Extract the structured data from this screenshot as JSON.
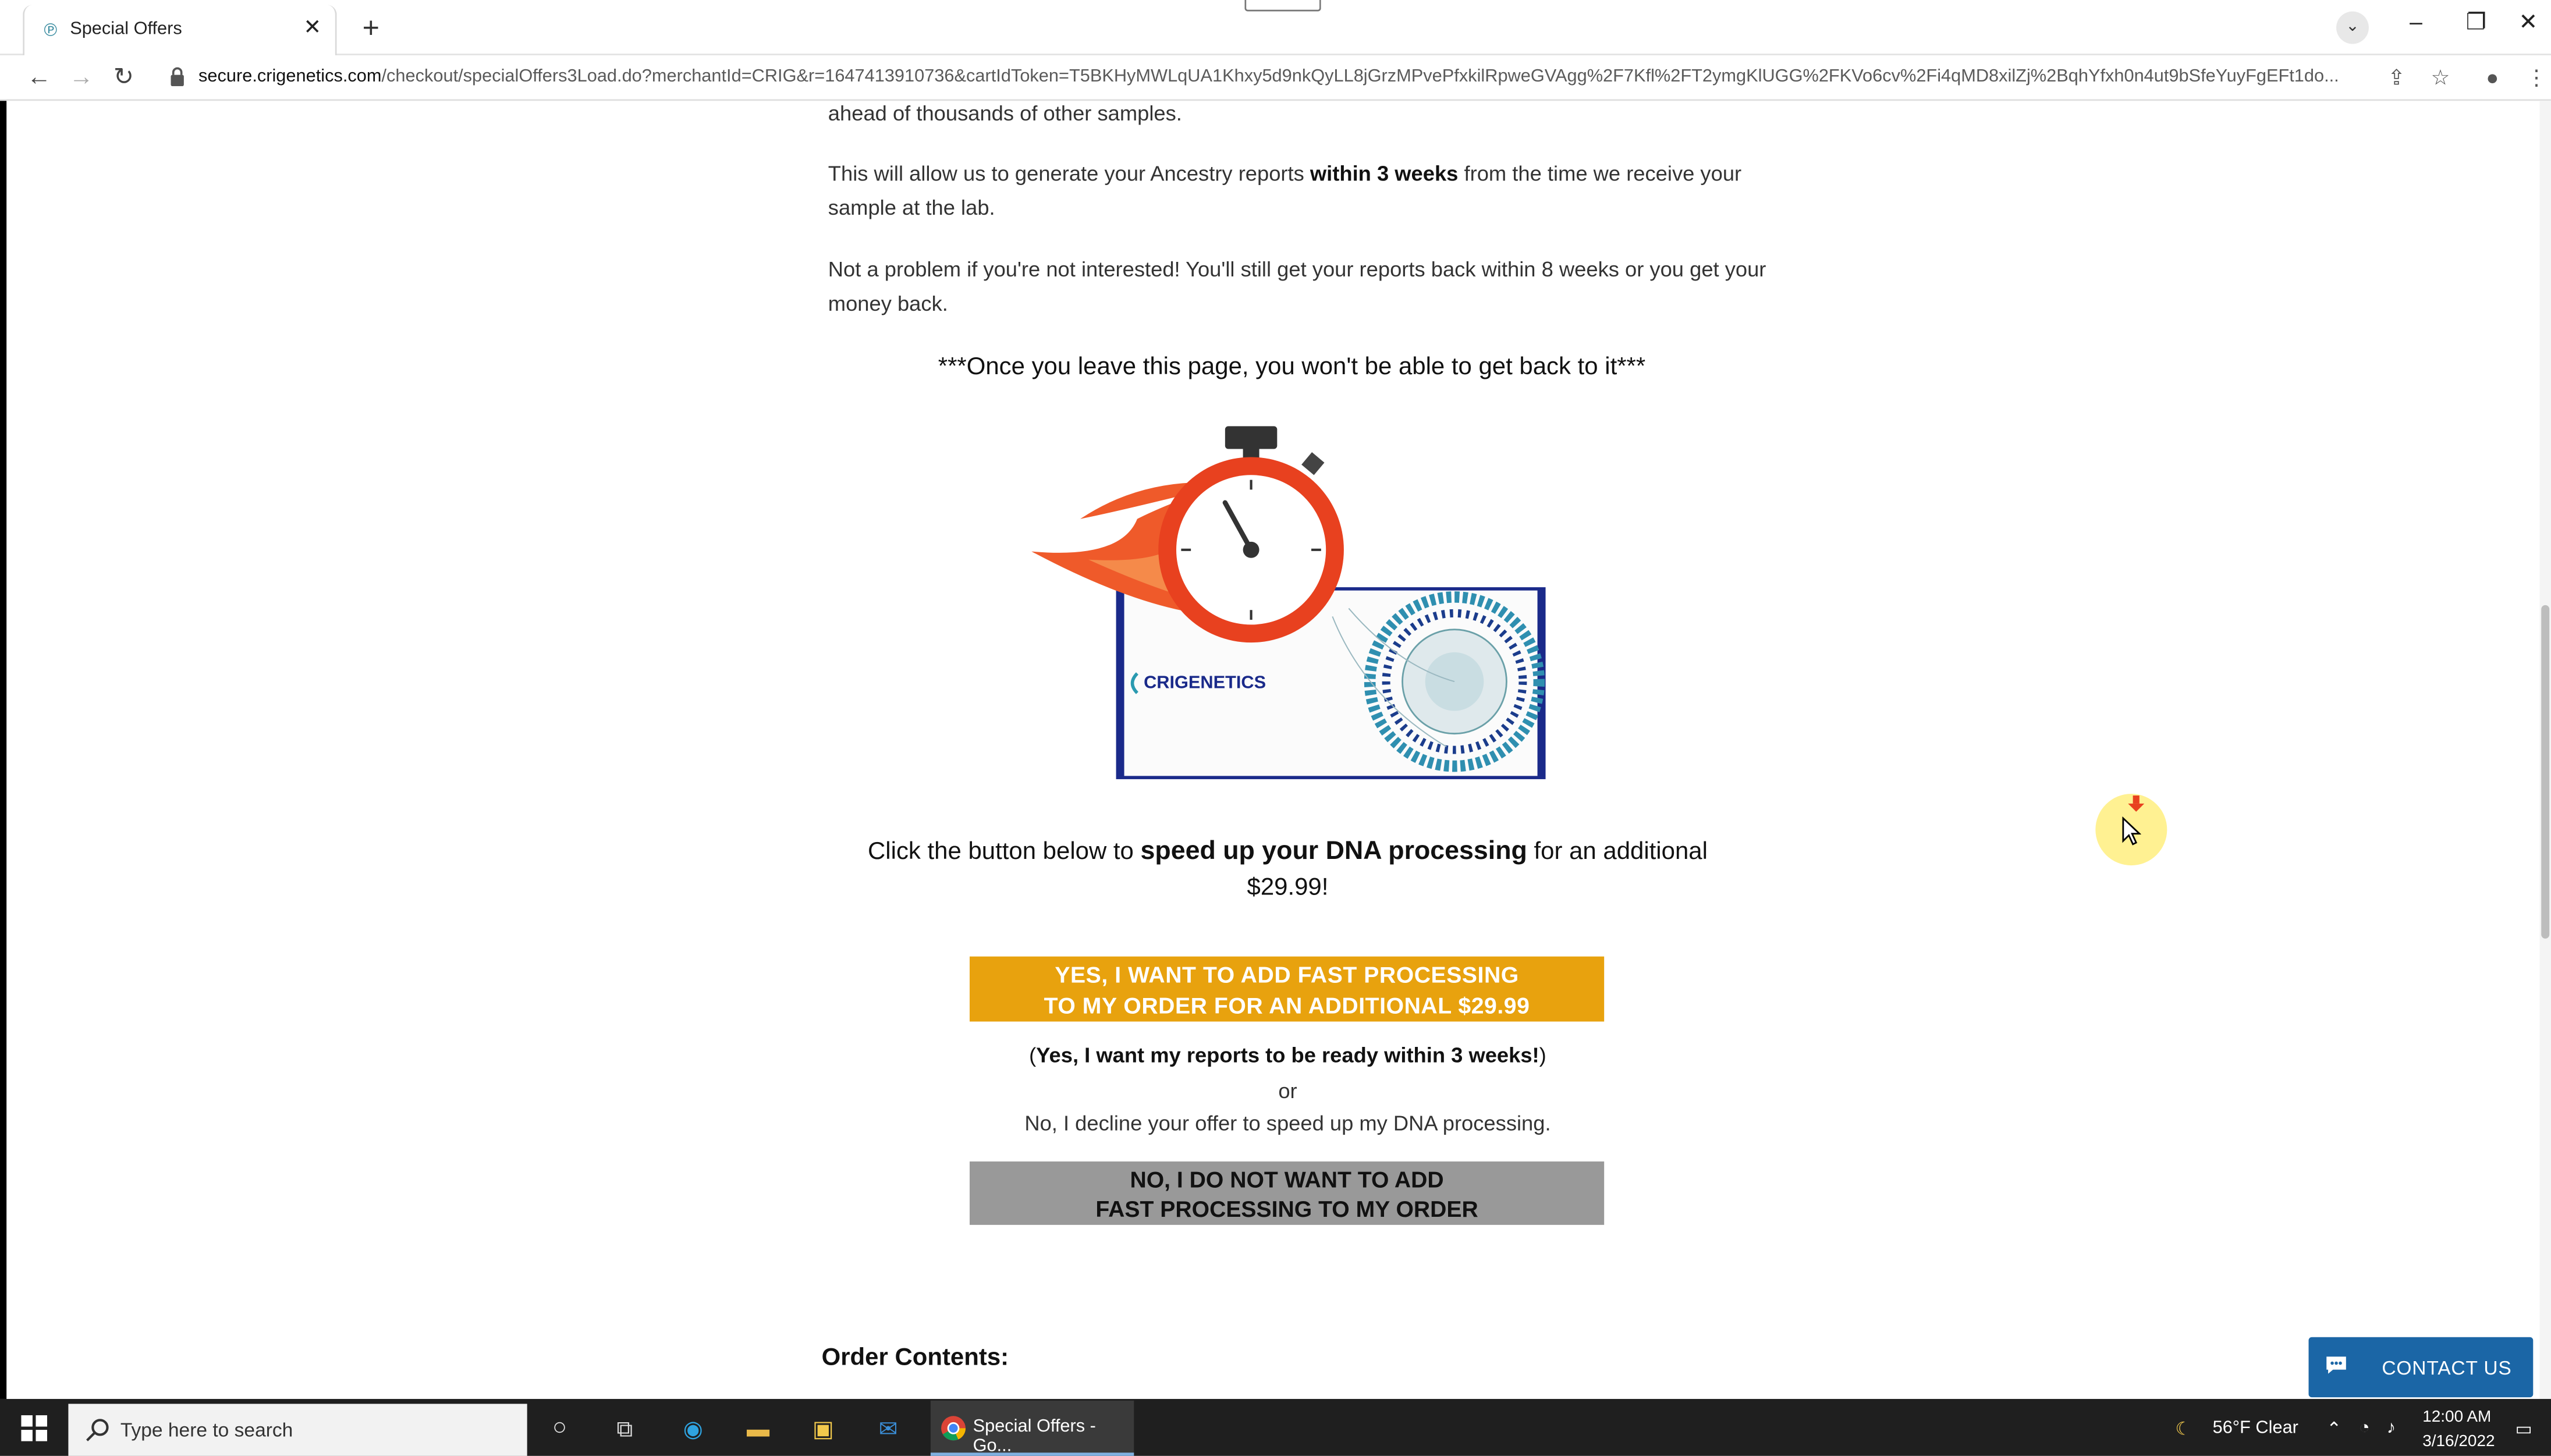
{
  "browser": {
    "tab_title": "Special Offers",
    "url_host": "secure.crigenetics.com",
    "url_path": "/checkout/specialOffers3Load.do?merchantId=CRIG&r=1647413910736&cartIdToken=T5BKHyMWLqUA1Khxy5d9nkQyLL8jGrzMPvePfxkilRpweGVAgg%2F7Kfl%2FT2ymgKlUGG%2FKVo6cv%2Fi4qMD8xilZj%2BqhYfxh0n4ut9bSfeYuyFgEFt1do..."
  },
  "content": {
    "line_top": "ahead of thousands of other samples.",
    "para1_a": "This will allow us to generate your Ancestry reports ",
    "para1_bold": "within 3 weeks",
    "para1_b": " from the time we receive your sample at the lab.",
    "para2": "Not a problem if you're not interested! You'll still get your reports back within 8 weeks or you get your money back.",
    "warning": "***Once you leave this page, you won't be able to get back to it***",
    "hero_brand": "CRIGENETICS",
    "cta_a": "Click the button below to ",
    "cta_bold": "speed up your DNA processing",
    "cta_b": " for an additional",
    "price": "$29.99!",
    "yes_line1": "YES, I WANT TO ADD FAST PROCESSING",
    "yes_line2": "TO MY ORDER FOR AN ADDITIONAL $29.99",
    "yes_note_open": "(",
    "yes_note_bold": "Yes, I want my reports to be ready within 3 weeks!",
    "yes_note_close": ")",
    "or": "or",
    "decline": "No, I decline your offer to speed up my DNA processing.",
    "no_line1": "NO, I DO NOT WANT TO ADD",
    "no_line2": "FAST PROCESSING TO MY ORDER",
    "order_title": "Order Contents:",
    "contact": "CONTACT US"
  },
  "taskbar": {
    "search_placeholder": "Type here to search",
    "chrome_label": "Special Offers - Go...",
    "weather": "56°F  Clear",
    "time": "12:00 AM",
    "date": "3/16/2022"
  },
  "colors": {
    "accent_yes": "#e8a20e",
    "accent_no": "#999999",
    "contact": "#1b66a6",
    "timer_red": "#e8411f"
  }
}
